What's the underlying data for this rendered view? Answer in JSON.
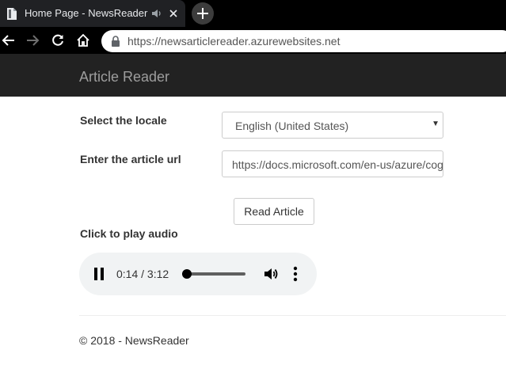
{
  "browser": {
    "tab": {
      "title": "Home Page - NewsReader"
    },
    "address_bar": {
      "url": "https://newsarticlereader.azurewebsites.net"
    }
  },
  "navbar": {
    "brand": "Article Reader"
  },
  "form": {
    "locale_label": "Select the locale",
    "locale_selected": "English (United States)",
    "url_label": "Enter the article url",
    "url_value": "https://docs.microsoft.com/en-us/azure/cognitive-services/speech-service/",
    "read_button": "Read Article"
  },
  "audio": {
    "label": "Click to play audio",
    "current_time": "0:14",
    "duration": "3:12",
    "time_display": "0:14 / 3:12",
    "progress_fraction": 0.07,
    "state": "playing"
  },
  "footer": {
    "text": "© 2018 - NewsReader"
  },
  "icons": {
    "favicon": "document-icon",
    "tab_audio": "speaker-icon",
    "tab_close": "close-icon",
    "new_tab": "plus-icon",
    "back": "back-arrow-icon",
    "forward": "forward-arrow-icon",
    "reload": "reload-icon",
    "home": "home-icon",
    "lock": "lock-icon",
    "pause": "pause-icon",
    "volume": "volume-icon",
    "more": "more-vertical-icon"
  },
  "colors": {
    "navbar_bg": "#222222",
    "brand_text": "#9d9d9d",
    "player_bg": "#f1f3f4",
    "chrome_bg": "#000000"
  }
}
